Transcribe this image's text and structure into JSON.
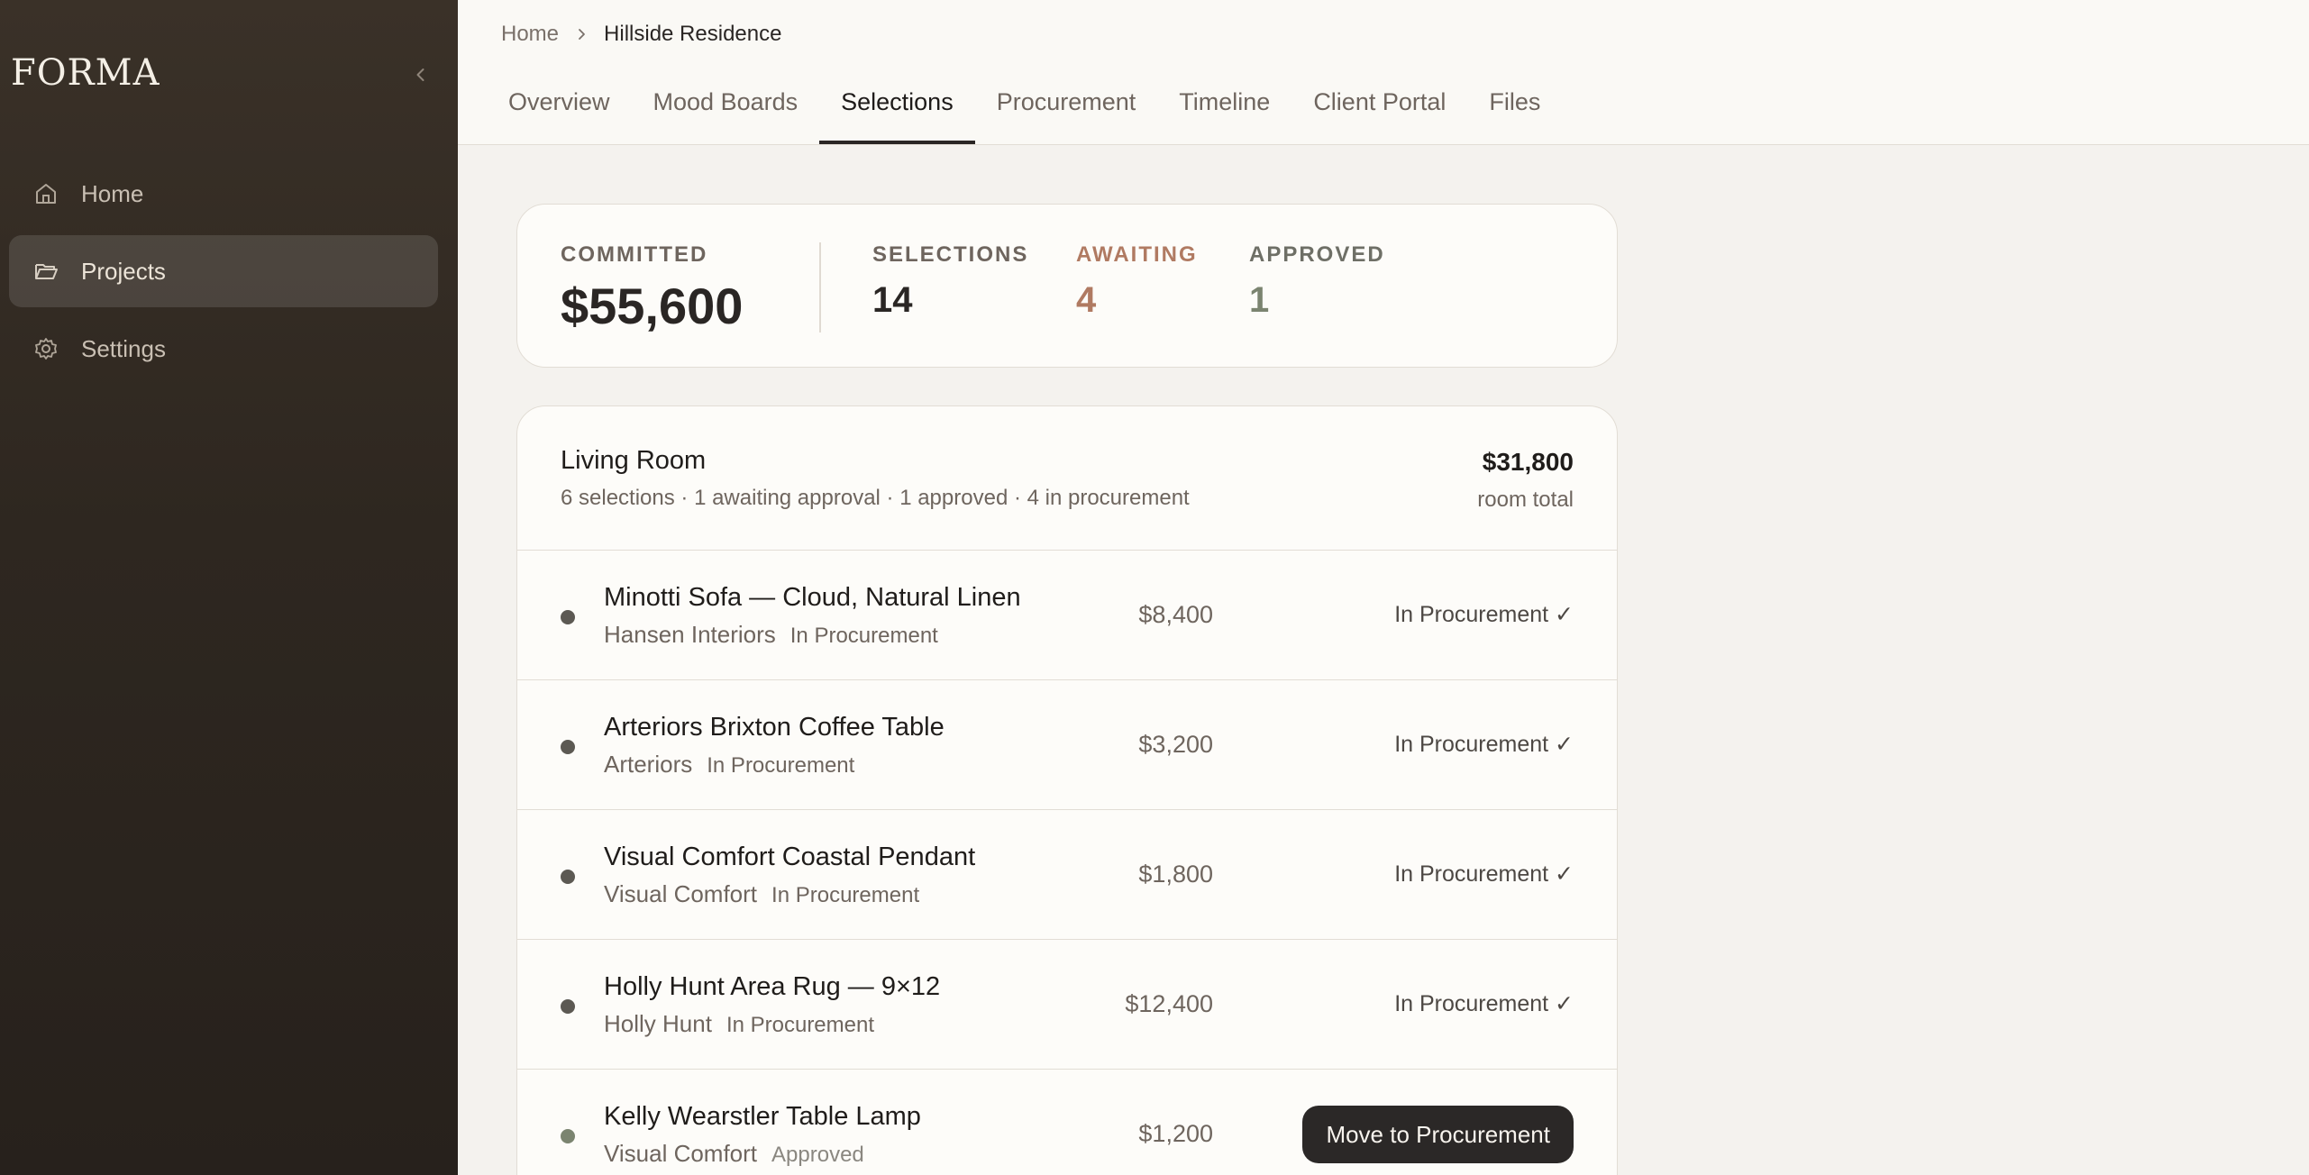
{
  "sidebar": {
    "brand": "FORMA",
    "items": [
      {
        "label": "Home",
        "icon": "home-icon"
      },
      {
        "label": "Projects",
        "icon": "folder-open-icon",
        "active": true
      },
      {
        "label": "Settings",
        "icon": "gear-icon"
      }
    ],
    "collapse_icon": "chevron-left-icon"
  },
  "breadcrumb": {
    "home": "Home",
    "current": "Hillside Residence"
  },
  "tabs": [
    {
      "label": "Overview"
    },
    {
      "label": "Mood Boards"
    },
    {
      "label": "Selections",
      "active": true
    },
    {
      "label": "Procurement"
    },
    {
      "label": "Timeline"
    },
    {
      "label": "Client Portal"
    },
    {
      "label": "Files"
    }
  ],
  "summary": {
    "committed_label": "COMMITTED",
    "committed_value": "$55,600",
    "selections_label": "SELECTIONS",
    "selections_value": "14",
    "awaiting_label": "AWAITING",
    "awaiting_value": "4",
    "approved_label": "APPROVED",
    "approved_value": "1"
  },
  "room": {
    "title": "Living Room",
    "meta": "6 selections · 1 awaiting approval · 1 approved · 4 in procurement",
    "total": "$31,800",
    "total_label": "room total",
    "items": [
      {
        "name": "Minotti Sofa — Cloud, Natural Linen",
        "vendor": "Hansen Interiors",
        "status": "In Procurement",
        "price": "$8,400",
        "action": "In Procurement ✓"
      },
      {
        "name": "Arteriors Brixton Coffee Table",
        "vendor": "Arteriors",
        "status": "In Procurement",
        "price": "$3,200",
        "action": "In Procurement ✓"
      },
      {
        "name": "Visual Comfort Coastal Pendant",
        "vendor": "Visual Comfort",
        "status": "In Procurement",
        "price": "$1,800",
        "action": "In Procurement ✓"
      },
      {
        "name": "Holly Hunt Area Rug — 9×12",
        "vendor": "Holly Hunt",
        "status": "In Procurement",
        "price": "$12,400",
        "action": "In Procurement ✓"
      },
      {
        "name": "Kelly Wearstler Table Lamp",
        "vendor": "Visual Comfort",
        "status": "Approved",
        "price": "$1,200",
        "action": "Move to Procurement"
      }
    ]
  },
  "colors": {
    "sidebar_bg": "#2e2720",
    "awaiting_accent": "#b07a62",
    "approved_accent": "#7b8470",
    "button_bg": "#2b2827"
  }
}
